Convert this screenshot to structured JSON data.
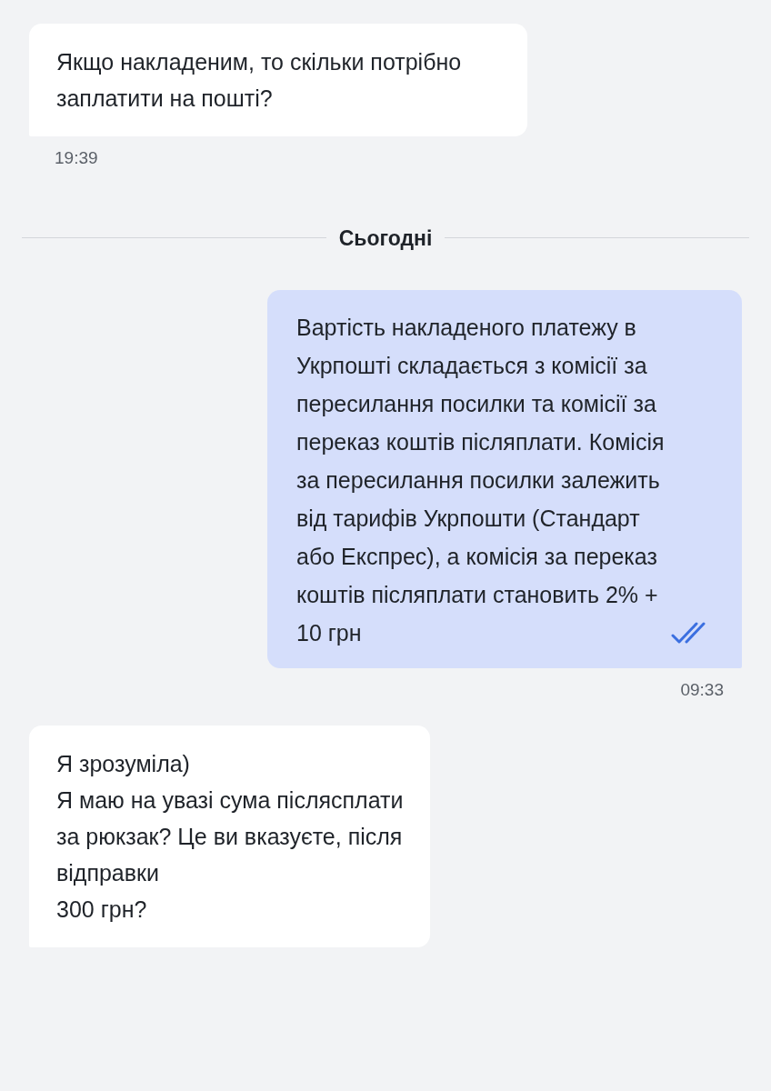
{
  "messages": [
    {
      "kind": "incoming",
      "text": "Якщо накладеним, то скільки потрібно заплатити на пошті?",
      "time": "19:39"
    },
    {
      "kind": "divider",
      "label": "Сьогодні"
    },
    {
      "kind": "outgoing",
      "text": "Вартість накладеного платежу в Укрпошті складається з комісії за пересилання посилки та комісії за переказ коштів післяплати. Комісія за пересилання посилки залежить від тарифів Укрпошти (Стандарт або Експрес), а комісія за переказ коштів післяплати становить 2% + 10 грн",
      "time": "09:33",
      "read": true
    },
    {
      "kind": "incoming",
      "text": "Я зрозуміла)\nЯ маю на увазі сума післясплати\nза рюкзак? Це ви вказуєте, після\nвідправки\n300 грн?"
    }
  ]
}
